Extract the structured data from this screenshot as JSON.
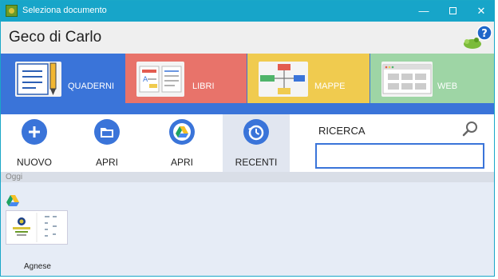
{
  "window": {
    "title": "Seleziona documento"
  },
  "header": {
    "user_name": "Geco di Carlo"
  },
  "tabs": [
    {
      "label": "QUADERNI"
    },
    {
      "label": "LIBRI"
    },
    {
      "label": "MAPPE"
    },
    {
      "label": "WEB"
    }
  ],
  "active_tab": "QUADERNI",
  "actions": [
    {
      "label": "NUOVO",
      "icon": "plus-icon"
    },
    {
      "label": "APRI",
      "icon": "folder-icon"
    },
    {
      "label": "APRI",
      "icon": "google-drive-icon"
    },
    {
      "label": "RECENTI",
      "icon": "history-icon"
    }
  ],
  "active_action": "RECENTI",
  "search": {
    "label": "RICERCA",
    "value": ""
  },
  "content": {
    "section_label": "Oggi",
    "documents": [
      {
        "name": "Agnese",
        "source_icon": "google-drive-icon"
      }
    ]
  },
  "colors": {
    "titlebar": "#17a5c9",
    "accent_blue": "#3a74d9",
    "quaderni": "#3a74d9",
    "libri": "#e8736a",
    "mappe": "#f0cb4f",
    "web": "#9ed5a5",
    "content_bg": "#e6ecf6"
  }
}
